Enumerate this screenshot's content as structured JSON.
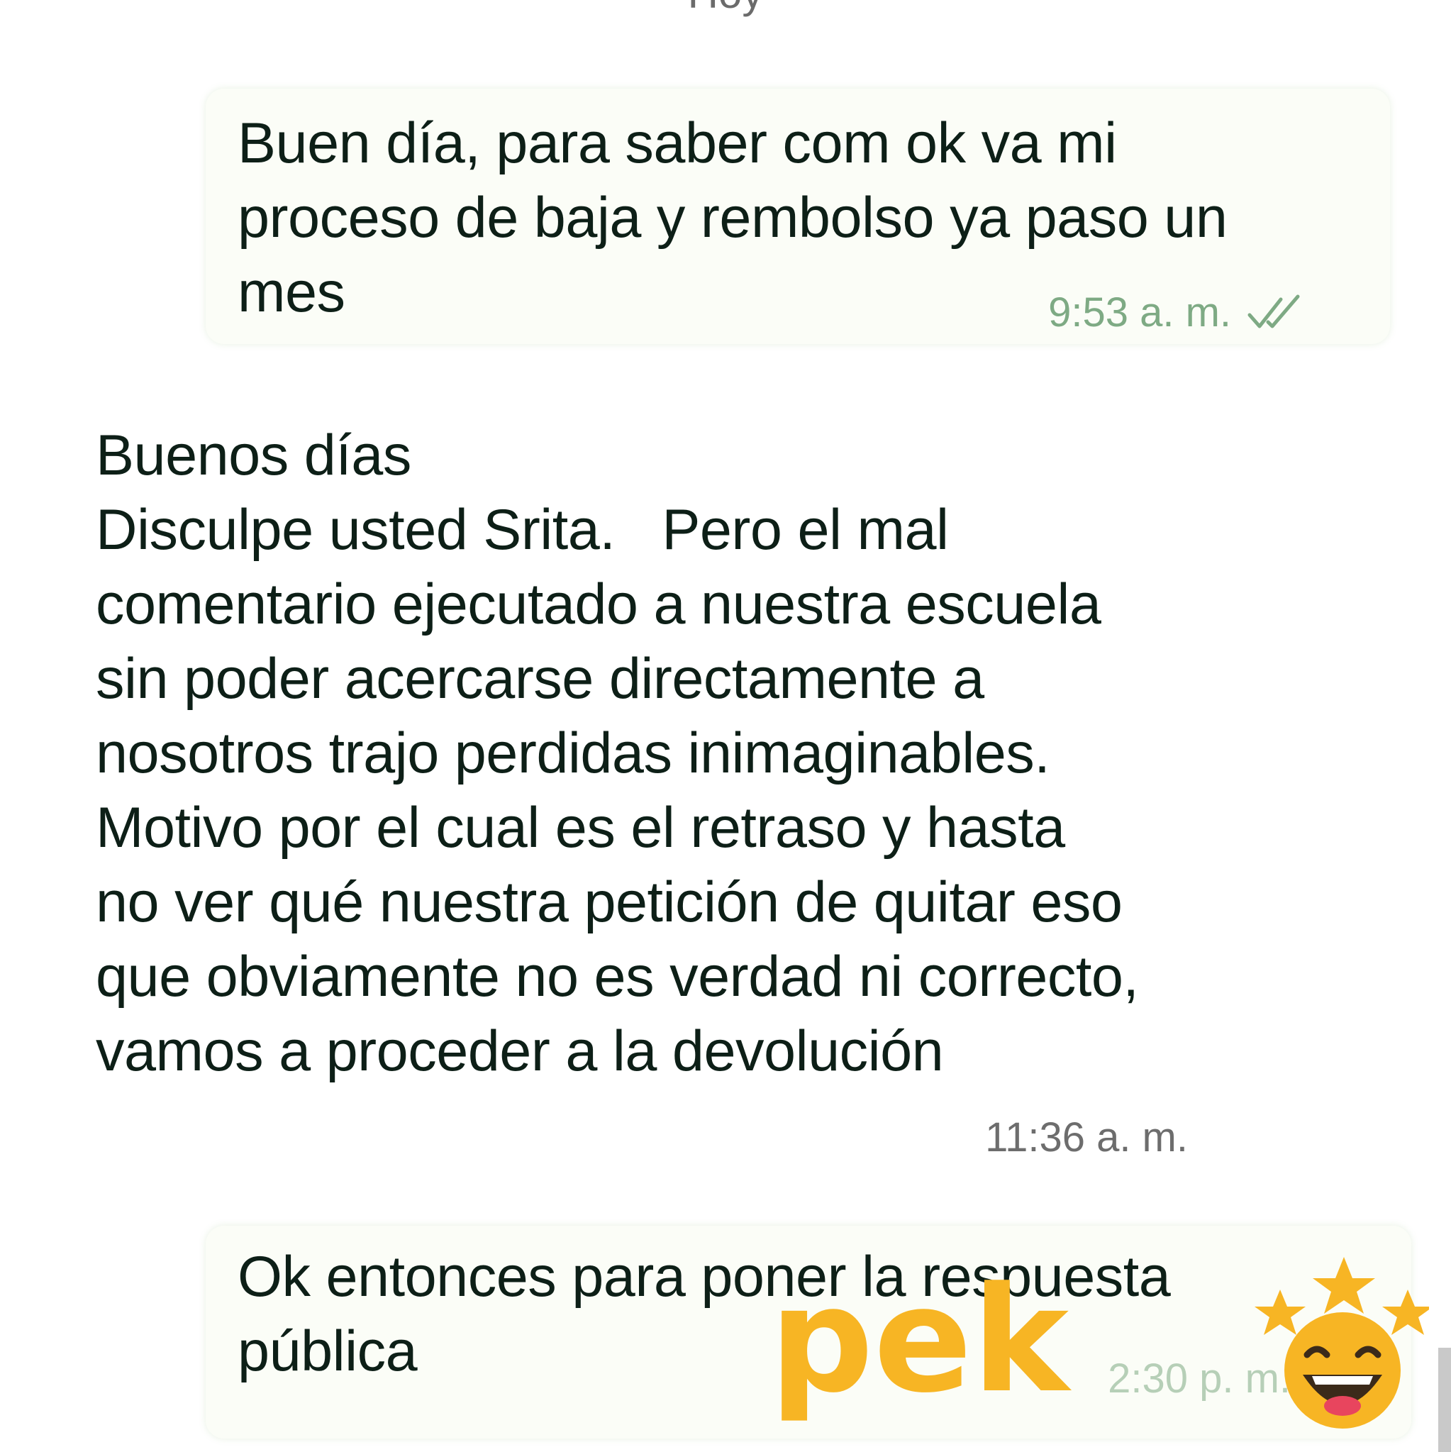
{
  "chat": {
    "date_separator": "Hoy",
    "messages": [
      {
        "direction": "outgoing",
        "text": "Buen día, para saber com ok va mi\nproceso de baja y rembolso ya paso un\nmes",
        "time": "9:53 a. m.",
        "status_icon": "double-check-icon"
      },
      {
        "direction": "incoming",
        "text": "Buenos días\nDisculpe usted Srita.   Pero el mal\ncomentario ejecutado a nuestra escuela\nsin poder acercarse directamente a\nnosotros trajo perdidas inimaginables.\nMotivo por el cual es el retraso y hasta\nno ver qué nuestra petición de quitar eso\nque obviamente no es verdad ni correcto,\nvamos a proceder a la devolución",
        "time": "11:36 a. m."
      },
      {
        "direction": "outgoing",
        "text": "Ok entonces para poner la respuesta\npública",
        "time": "2:30 p. m."
      }
    ]
  },
  "watermark": {
    "text": "pek",
    "icon": "laughing-face-stars-icon",
    "color": "#f7b524"
  },
  "colors": {
    "outgoing_bubble": "#fbfdf7",
    "outgoing_meta": "#7eaa84",
    "incoming_meta": "#6d6d6d",
    "text": "#0d1f17"
  }
}
